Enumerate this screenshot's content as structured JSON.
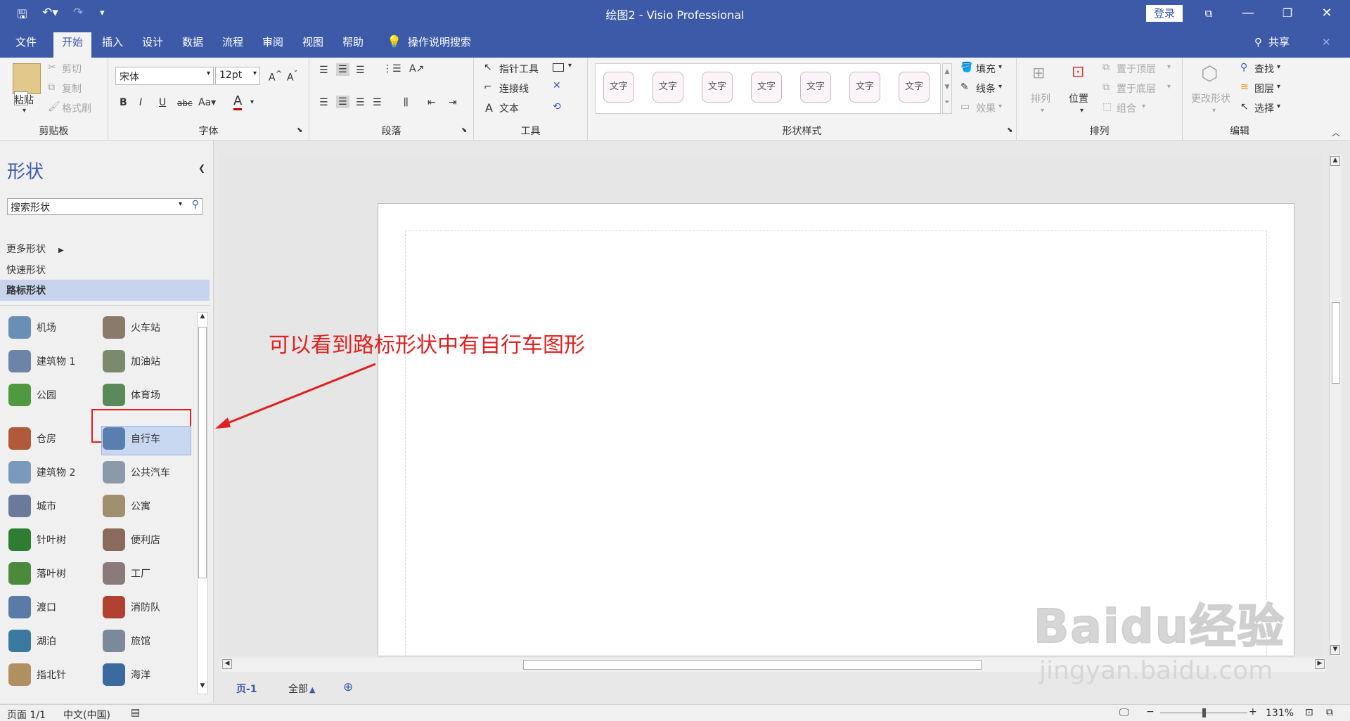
{
  "titlebar": {
    "title": "绘图2  -  Visio Professional",
    "login": "登录"
  },
  "tabs": [
    "文件",
    "开始",
    "插入",
    "设计",
    "数据",
    "流程",
    "审阅",
    "视图",
    "帮助",
    "操作说明搜索"
  ],
  "share": "共享",
  "ribbon": {
    "clipboard": {
      "label": "剪贴板",
      "paste": "粘贴",
      "cut": "剪切",
      "copy": "复制",
      "format_painter": "格式刷"
    },
    "font": {
      "label": "字体",
      "font_name": "宋体",
      "font_size": "12pt"
    },
    "paragraph": {
      "label": "段落"
    },
    "tools": {
      "label": "工具",
      "pointer": "指针工具",
      "connector": "连接线",
      "text": "文本"
    },
    "shape_styles": {
      "label": "形状样式",
      "preset_text": "文字",
      "fill": "填充",
      "line": "线条",
      "effects": "效果"
    },
    "arrange": {
      "label": "排列",
      "arrange": "排列",
      "position": "位置",
      "bring_front": "置于顶层",
      "send_back": "置于底层",
      "group": "组合"
    },
    "editing": {
      "label": "编辑",
      "change_shape": "更改形状",
      "find": "查找",
      "layers": "图层",
      "select": "选择"
    }
  },
  "shapes_panel": {
    "title": "形状",
    "search_placeholder": "搜索形状",
    "more_shapes": "更多形状",
    "quick_shapes": "快速形状",
    "current_stencil": "路标形状",
    "items": [
      {
        "label": "机场",
        "color": "#6a8fb5"
      },
      {
        "label": "火车站",
        "color": "#8a7a6a"
      },
      {
        "label": "建筑物 1",
        "color": "#6c84a8"
      },
      {
        "label": "加油站",
        "color": "#7a8a6a"
      },
      {
        "label": "公园",
        "color": "#4f9a3e"
      },
      {
        "label": "体育场",
        "color": "#5a8a5a"
      },
      {
        "label": "仓房",
        "color": "#b05a3a"
      },
      {
        "label": "自行车",
        "color": "#5a7fae"
      },
      {
        "label": "建筑物 2",
        "color": "#7a9abb"
      },
      {
        "label": "公共汽车",
        "color": "#8a9aaa"
      },
      {
        "label": "城市",
        "color": "#6a7a9a"
      },
      {
        "label": "公寓",
        "color": "#a09070"
      },
      {
        "label": "针叶树",
        "color": "#2e7d32"
      },
      {
        "label": "便利店",
        "color": "#8a6a5a"
      },
      {
        "label": "落叶树",
        "color": "#4a8a3a"
      },
      {
        "label": "工厂",
        "color": "#8a7a7a"
      },
      {
        "label": "渡口",
        "color": "#5a7aa8"
      },
      {
        "label": "消防队",
        "color": "#b04030"
      },
      {
        "label": "湖泊",
        "color": "#3a7aa0"
      },
      {
        "label": "旅馆",
        "color": "#7a8a9a"
      },
      {
        "label": "指北针",
        "color": "#b09060"
      },
      {
        "label": "海洋",
        "color": "#3a6aa0"
      }
    ]
  },
  "annotation": "可以看到路标形状中有自行车图形",
  "page_tabs": {
    "page": "页-1",
    "all": "全部"
  },
  "statusbar": {
    "page": "页面 1/1",
    "language": "中文(中国)",
    "zoom": "131%"
  },
  "watermark": {
    "brand": "Baidu经验",
    "url": "jingyan.baidu.com"
  }
}
